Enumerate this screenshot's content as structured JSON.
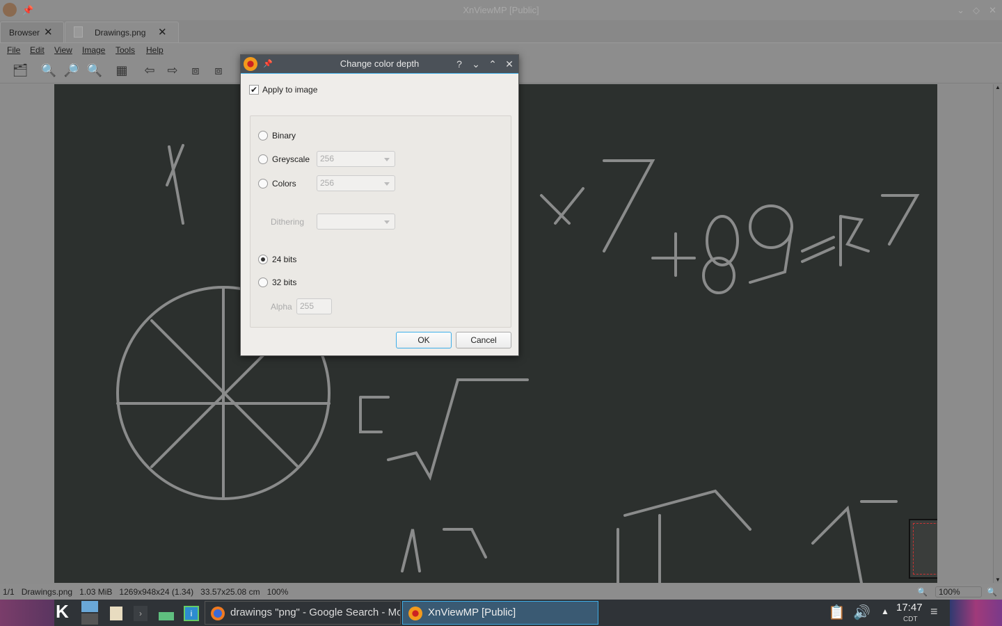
{
  "window": {
    "title": "XnViewMP [Public]"
  },
  "tabs": [
    {
      "label": "Browser"
    },
    {
      "label": "Drawings.png"
    }
  ],
  "menu": [
    "File",
    "Edit",
    "View",
    "Image",
    "Tools",
    "Help"
  ],
  "dialog": {
    "title": "Change color depth",
    "apply_label": "Apply to image",
    "apply_checked": true,
    "binary": "Binary",
    "greyscale": "Greyscale",
    "greyscale_value": "256",
    "colors": "Colors",
    "colors_value": "256",
    "dithering": "Dithering",
    "dithering_value": "",
    "bits24": "24 bits",
    "bits32": "32 bits",
    "selected": "24 bits",
    "alpha": "Alpha",
    "alpha_value": "255",
    "ok": "OK",
    "cancel": "Cancel"
  },
  "status": {
    "index": "1/1",
    "file": "Drawings.png",
    "size": "1.03 MiB",
    "dims": "1269x948x24 (1.34)",
    "physical": "33.57x25.08 cm",
    "zoom": "100%",
    "zoom_box": "100%"
  },
  "taskbar": {
    "tasks": [
      "drawings \"png\" - Google Search - Mozilla Firefox",
      "XnViewMP [Public]"
    ],
    "time": "17:47",
    "tz": "CDT"
  },
  "colors": {
    "accent": "#3daee9",
    "canvas": "#2c302e",
    "taskbar": "#2f3337"
  }
}
